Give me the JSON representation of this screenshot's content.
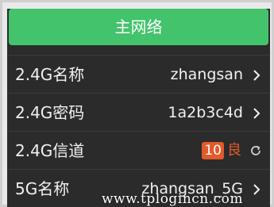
{
  "header": {
    "title": "主网络"
  },
  "rows": [
    {
      "label": "2.4G名称",
      "value": "zhangsan"
    },
    {
      "label": "2.4G密码",
      "value": "1a2b3c4d"
    },
    {
      "label": "2.4G信道",
      "channel": "10",
      "quality": "良"
    },
    {
      "label": "5G名称",
      "value": "zhangsan_5G"
    }
  ],
  "watermark": "www.tplogincn.com",
  "colors": {
    "accent": "#43c36b",
    "panel_bg": "#2b2b2b",
    "badge": "#e25a2a"
  },
  "icons": {
    "chevron": "chevron-right-icon",
    "refresh": "refresh-icon"
  }
}
